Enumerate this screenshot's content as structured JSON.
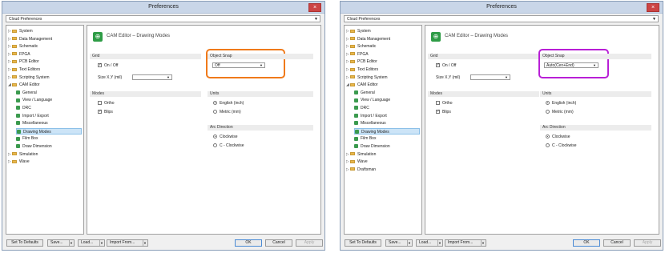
{
  "window": {
    "title": "Preferences",
    "close_label": "×"
  },
  "cloud_dropdown": {
    "value": "Cloud Preferences"
  },
  "tree": {
    "left": [
      "System",
      "Data Management",
      "Schematic",
      "FPGA",
      "PCB Editor",
      "Text Editors",
      "Scripting System",
      "CAM Editor",
      "General",
      "View / Language",
      "DRC",
      "Import / Export",
      "Miscellaneous",
      "Drawing Modes",
      "Film Box",
      "Draw Dimension",
      "Simulation",
      "Wave"
    ],
    "right": [
      "System",
      "Data Management",
      "Schematic",
      "FPGA",
      "PCB Editor",
      "Text Editors",
      "Scripting System",
      "CAM Editor",
      "General",
      "View / Language",
      "DRC",
      "Import / Export",
      "Miscellaneous",
      "Drawing Modes",
      "Film Box",
      "Draw Dimension",
      "Simulation",
      "Wave",
      "Draftsman"
    ]
  },
  "panel": {
    "header": "CAM Editor – Drawing Modes",
    "grid_section": "Grid",
    "on_off_label": "On / Off",
    "size_xy_label": "Size X,Y (mil)",
    "modes_section": "Modes",
    "ortho_label": "Ortho",
    "blips_label": "Blips",
    "object_snap_section": "Object Snap",
    "snap_left_value": "Off",
    "snap_right_value": "Auto(Cen+End)",
    "units_section": "Units",
    "english_label": "English (inch)",
    "metric_label": "Metric (mm)",
    "arc_section": "Arc Direction",
    "clockwise_label": "Clockwise",
    "cclockwise_label": "C - Clockwise"
  },
  "buttons": {
    "set_to_defaults": "Set To Defaults",
    "save": "Save...",
    "load": "Load...",
    "import_from": "Import From...",
    "ok": "OK",
    "cancel": "Cancel",
    "apply": "Apply"
  },
  "colors": {
    "highlight_left": "#f07a1a",
    "highlight_right": "#b81fd6"
  }
}
